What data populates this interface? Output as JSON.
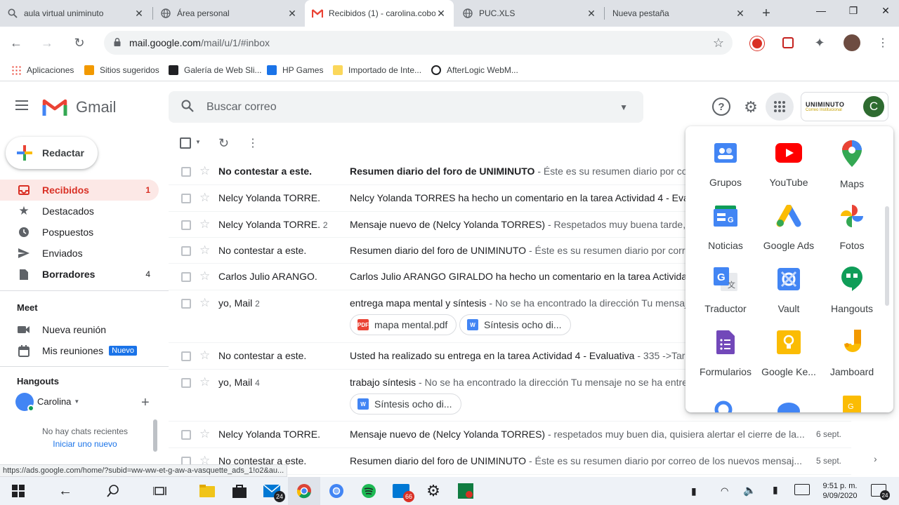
{
  "browser": {
    "tabs": [
      {
        "label": "aula virtual uniminuto",
        "icon": "search-icon"
      },
      {
        "label": "Área personal",
        "icon": "globe-icon"
      },
      {
        "label": "Recibidos (1) - carolina.cobo",
        "icon": "gmail-icon",
        "active": true
      },
      {
        "label": "PUC.XLS",
        "icon": "globe-icon"
      },
      {
        "label": "Nueva pestaña",
        "icon": "none"
      }
    ],
    "url_host": "mail.google.com",
    "url_path": "/mail/u/1/#inbox",
    "bookmarks": [
      {
        "label": "Aplicaciones",
        "color": "#4285f4"
      },
      {
        "label": "Sitios sugeridos",
        "color": "#f29900"
      },
      {
        "label": "Galería de Web Sli...",
        "color": "#202124"
      },
      {
        "label": "HP Games",
        "color": "#1a73e8"
      },
      {
        "label": "Importado de Inte...",
        "color": "#fbbc04"
      },
      {
        "label": "AfterLogic WebM...",
        "color": "#202124"
      }
    ]
  },
  "gmail": {
    "logo_text": "Gmail",
    "search_placeholder": "Buscar correo",
    "account_initial": "C",
    "org_logo_text": "UNIMINUTO",
    "org_logo_sub": "Correo Institucional",
    "compose_label": "Redactar",
    "nav": [
      {
        "label": "Recibidos",
        "count": "1",
        "icon": "inbox-icon",
        "active": true
      },
      {
        "label": "Destacados",
        "count": "",
        "icon": "star-icon"
      },
      {
        "label": "Pospuestos",
        "count": "",
        "icon": "clock-icon"
      },
      {
        "label": "Enviados",
        "count": "",
        "icon": "send-icon"
      },
      {
        "label": "Borradores",
        "count": "4",
        "icon": "draft-icon"
      }
    ],
    "meet": {
      "title": "Meet",
      "items": [
        {
          "label": "Nueva reunión",
          "icon": "video-icon"
        },
        {
          "label": "Mis reuniones",
          "icon": "calendar-icon",
          "badge": "Nuevo"
        }
      ]
    },
    "hangouts": {
      "title": "Hangouts",
      "user": "Carolina",
      "empty_text": "No hay chats recientes",
      "start_link": "Iniciar uno nuevo"
    },
    "emails": [
      {
        "sender": "No contestar a este.",
        "count": "",
        "subject": "Resumen diario del foro de UNIMINUTO",
        "snippet": " - Éste es su resumen diario por correo de los nuevos mensaj...",
        "date": "",
        "unread": true,
        "attachments": []
      },
      {
        "sender": "Nelcy Yolanda TORRE.",
        "count": "",
        "subject": "Nelcy Yolanda TORRES ha hecho un comentario en la tarea Actividad 4 - Evaluativa",
        "snippet": "",
        "date": "",
        "unread": false,
        "attachments": []
      },
      {
        "sender": "Nelcy Yolanda TORRE.",
        "count": "2",
        "subject": "Mensaje nuevo de (Nelcy Yolanda TORRES)",
        "snippet": " - Respetados muy buena tarde, en la",
        "date": "",
        "unread": false,
        "attachments": []
      },
      {
        "sender": "No contestar a este.",
        "count": "",
        "subject": "Resumen diario del foro de UNIMINUTO",
        "snippet": " - Éste es su resumen diario por correo de",
        "date": "",
        "unread": false,
        "attachments": []
      },
      {
        "sender": "Carlos Julio ARANGO.",
        "count": "",
        "subject": "Carlos Julio ARANGO GIRALDO ha hecho un comentario en la tarea Actividad 2",
        "snippet": "",
        "date": "",
        "unread": false,
        "attachments": []
      },
      {
        "sender": "yo, Mail",
        "count": "2",
        "subject": "entrega mapa mental y síntesis",
        "snippet": " - No se ha encontrado la dirección Tu mensaje no",
        "date": "",
        "unread": false,
        "attachments": [
          {
            "label": "mapa mental.pdf",
            "type": "pdf"
          },
          {
            "label": "Síntesis ocho di...",
            "type": "word"
          }
        ]
      },
      {
        "sender": "No contestar a este.",
        "count": "",
        "subject": "Usted ha realizado su entrega en la tarea Actividad 4 - Evaluativa",
        "snippet": " - 335 ->Tarea - ",
        "date": "",
        "unread": false,
        "attachments": []
      },
      {
        "sender": "yo, Mail",
        "count": "4",
        "subject": "trabajo síntesis",
        "snippet": " - No se ha encontrado la dirección Tu mensaje no se ha entrega",
        "date": "",
        "unread": false,
        "attachments": [
          {
            "label": "Síntesis ocho di...",
            "type": "word"
          }
        ]
      },
      {
        "sender": "Nelcy Yolanda TORRE.",
        "count": "",
        "subject": "Mensaje nuevo de (Nelcy Yolanda TORRES)",
        "snippet": " - respetados muy buen dia, quisiera alertar el cierre de la...",
        "date": "6 sept.",
        "unread": false,
        "attachments": []
      },
      {
        "sender": "No contestar a este.",
        "count": "",
        "subject": "Resumen diario del foro de UNIMINUTO",
        "snippet": " - Éste es su resumen diario por correo de los nuevos mensaj...",
        "date": "5 sept.",
        "unread": false,
        "attachments": []
      }
    ],
    "apps_panel": [
      {
        "label": "Grupos",
        "icon": "groups-icon"
      },
      {
        "label": "YouTube",
        "icon": "youtube-icon"
      },
      {
        "label": "Maps",
        "icon": "maps-icon"
      },
      {
        "label": "Noticias",
        "icon": "news-icon"
      },
      {
        "label": "Google Ads",
        "icon": "ads-icon"
      },
      {
        "label": "Fotos",
        "icon": "photos-icon"
      },
      {
        "label": "Traductor",
        "icon": "translate-icon"
      },
      {
        "label": "Vault",
        "icon": "vault-icon"
      },
      {
        "label": "Hangouts",
        "icon": "hangouts-icon"
      },
      {
        "label": "Formularios",
        "icon": "forms-icon"
      },
      {
        "label": "Google Ke...",
        "icon": "keep-icon"
      },
      {
        "label": "Jamboard",
        "icon": "jamboard-icon"
      }
    ]
  },
  "status_url": "https://ads.google.com/home/?subid=ww-ww-et-g-aw-a-vasquette_ads_1!o2&au...",
  "taskbar": {
    "time": "9:51 p. m.",
    "date": "9/09/2020",
    "notif_count": "24",
    "mail_badge": "24",
    "chrome_badge": "66"
  }
}
